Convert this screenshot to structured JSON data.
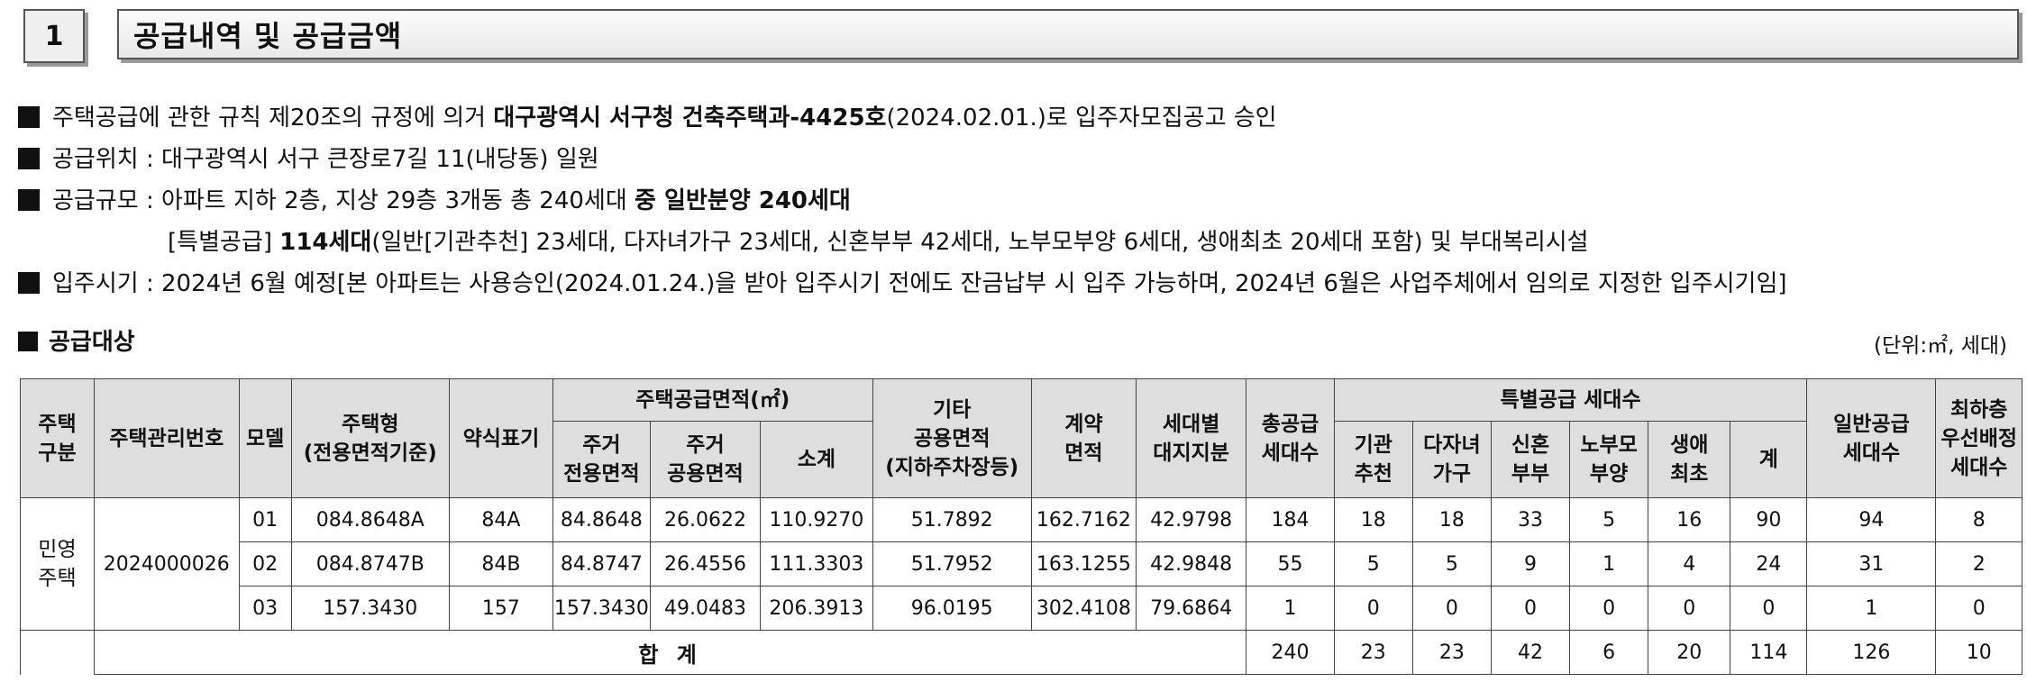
{
  "section": {
    "number": "1",
    "title": "공급내역 및 공급금액"
  },
  "info": {
    "line1": {
      "pre": "주택공급에 관한 규칙 제20조의 규정에 의거 ",
      "bold": "대구광역시 서구청 건축주택과-4425호",
      "post": "(2024.02.01.)로 입주자모집공고 승인"
    },
    "line2": "공급위치 : 대구광역시 서구 큰장로7길 11(내당동) 일원",
    "line3": {
      "pre": "공급규모 : 아파트 지하 2층, 지상 29층 3개동 총 240세대 ",
      "bold": "중 일반분양 240세대"
    },
    "line4": {
      "pre": "[특별공급] ",
      "bold": "114세대",
      "post": "(일반[기관추천] 23세대, 다자녀가구 23세대, 신혼부부 42세대, 노부모부양 6세대, 생애최초 20세대 포함) 및 부대복리시설"
    },
    "line5": "입주시기 : 2024년 6월 예정[본 아파트는 사용승인(2024.01.24.)을 받아 입주시기 전에도 잔금납부 시 입주 가능하며, 2024년 6월은 사업주체에서 임의로 지정한 입주시기임]"
  },
  "target": {
    "title": "공급대상",
    "unit": "(단위:㎡, 세대)"
  },
  "table": {
    "headers": {
      "housing_type": "주택\n구분",
      "mgmt_no": "주택관리번호",
      "model": "모델",
      "house_type": "주택형\n(전용면적기준)",
      "short": "약식표기",
      "area_group": "주택공급면적(㎡)",
      "excl_area": "주거\n전용면적",
      "common_area": "주거\n공용면적",
      "subtotal": "소계",
      "other_common": "기타\n공용면적\n(지하주차장등)",
      "contract_area": "계약\n면적",
      "land_share": "세대별\n대지지분",
      "total_units": "총공급\n세대수",
      "special_group": "특별공급 세대수",
      "sp_inst": "기관\n추천",
      "sp_multi": "다자녀\n가구",
      "sp_newly": "신혼\n부부",
      "sp_elder": "노부모\n부양",
      "sp_first": "생애\n최초",
      "sp_sum": "계",
      "general": "일반공급\n세대수",
      "lowest": "최하층\n우선배정\n세대수"
    },
    "housing_type": "민영\n주택",
    "mgmt_no": "2024000026",
    "rows": [
      {
        "model": "01",
        "type": "084.8648A",
        "short": "84A",
        "excl": "84.8648",
        "common": "26.0622",
        "subtotal": "110.9270",
        "other": "51.7892",
        "contract": "162.7162",
        "land": "42.9798",
        "total": "184",
        "inst": "18",
        "multi": "18",
        "newly": "33",
        "elder": "5",
        "first": "16",
        "sum": "90",
        "general": "94",
        "lowest": "8"
      },
      {
        "model": "02",
        "type": "084.8747B",
        "short": "84B",
        "excl": "84.8747",
        "common": "26.4556",
        "subtotal": "111.3303",
        "other": "51.7952",
        "contract": "163.1255",
        "land": "42.9848",
        "total": "55",
        "inst": "5",
        "multi": "5",
        "newly": "9",
        "elder": "1",
        "first": "4",
        "sum": "24",
        "general": "31",
        "lowest": "2"
      },
      {
        "model": "03",
        "type": "157.3430",
        "short": "157",
        "excl": "157.3430",
        "common": "49.0483",
        "subtotal": "206.3913",
        "other": "96.0195",
        "contract": "302.4108",
        "land": "79.6864",
        "total": "1",
        "inst": "0",
        "multi": "0",
        "newly": "0",
        "elder": "0",
        "first": "0",
        "sum": "0",
        "general": "1",
        "lowest": "0"
      }
    ],
    "totals": {
      "label": "합 계",
      "total": "240",
      "inst": "23",
      "multi": "23",
      "newly": "42",
      "elder": "6",
      "first": "20",
      "sum": "114",
      "general": "126",
      "lowest": "10"
    }
  }
}
